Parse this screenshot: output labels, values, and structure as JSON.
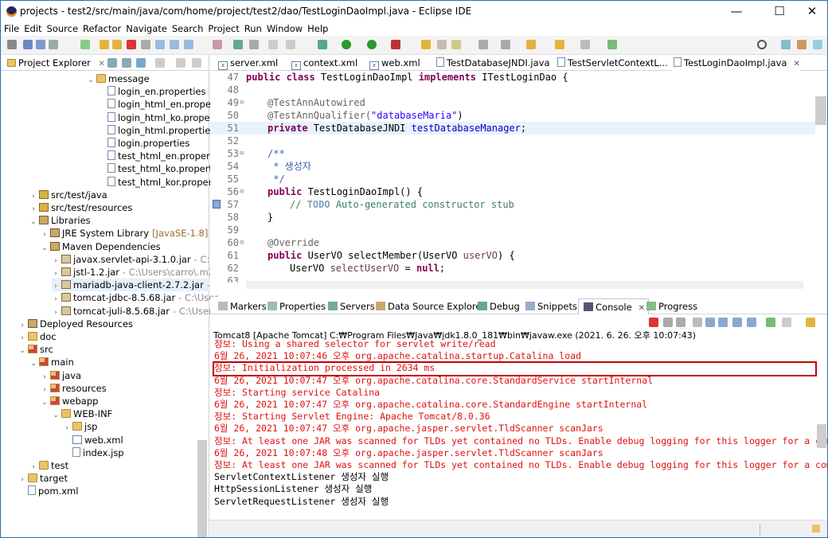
{
  "window": {
    "title": "projects - test2/src/main/java/com/home/project/test2/dao/TestLoginDaoImpl.java - Eclipse IDE",
    "minimize": "—",
    "maximize": "☐",
    "close": "✕"
  },
  "menu": [
    "File",
    "Edit",
    "Source",
    "Refactor",
    "Navigate",
    "Search",
    "Project",
    "Run",
    "Window",
    "Help"
  ],
  "explorer": {
    "title": "Project Explorer",
    "close": "✕",
    "tree": [
      {
        "label": "message",
        "icon": "folder-icon",
        "arrow": "⌄"
      },
      {
        "label": "login_en.properties",
        "icon": "file-icon"
      },
      {
        "label": "login_html_en.prope",
        "icon": "file-icon"
      },
      {
        "label": "login_html_ko.prope",
        "icon": "file-icon"
      },
      {
        "label": "login_html.propertie",
        "icon": "file-icon"
      },
      {
        "label": "login.properties",
        "icon": "file-icon"
      },
      {
        "label": "test_html_en.propert",
        "icon": "file-icon"
      },
      {
        "label": "test_html_ko.propert",
        "icon": "file-icon"
      },
      {
        "label": "test_html_kor.proper",
        "icon": "file-icon"
      },
      {
        "label": "src/test/java",
        "icon": "package-folder-icon",
        "arrow": "›"
      },
      {
        "label": "src/test/resources",
        "icon": "package-folder-icon",
        "arrow": "›"
      },
      {
        "label": "Libraries",
        "icon": "library-icon",
        "arrow": "⌄"
      },
      {
        "label": "JRE System Library",
        "extra": "[JavaSE-1.8]",
        "icon": "library-icon",
        "arrow": "›"
      },
      {
        "label": "Maven Dependencies",
        "icon": "library-icon",
        "arrow": "⌄"
      },
      {
        "label": "javax.servlet-api-3.1.0.jar",
        "extra": "- C:\\U",
        "icon": "jar-icon",
        "arrow": "›"
      },
      {
        "label": "jstl-1.2.jar",
        "extra": "- C:\\Users\\carro\\.m2",
        "icon": "jar-icon",
        "arrow": "›"
      },
      {
        "label": "mariadb-java-client-2.7.2.jar",
        "extra": "- C:",
        "icon": "jar-icon",
        "arrow": "›"
      },
      {
        "label": "tomcat-jdbc-8.5.68.jar",
        "extra": "- C:\\User",
        "icon": "jar-icon",
        "arrow": "›"
      },
      {
        "label": "tomcat-juli-8.5.68.jar",
        "extra": "- C:\\User",
        "icon": "jar-icon",
        "arrow": "›"
      },
      {
        "label": "Deployed Resources",
        "icon": "deployed-icon",
        "arrow": "›"
      },
      {
        "label": "doc",
        "icon": "folder-icon",
        "arrow": "›"
      },
      {
        "label": "src",
        "icon": "src-folder-icon",
        "arrow": "⌄"
      },
      {
        "label": "main",
        "icon": "src-folder-icon",
        "arrow": "⌄"
      },
      {
        "label": "java",
        "icon": "src-folder-icon",
        "arrow": "›"
      },
      {
        "label": "resources",
        "icon": "src-folder-icon",
        "arrow": "›"
      },
      {
        "label": "webapp",
        "icon": "src-folder-icon",
        "arrow": "⌄"
      },
      {
        "label": "WEB-INF",
        "icon": "folder-icon",
        "arrow": "⌄"
      },
      {
        "label": "jsp",
        "icon": "folder-icon",
        "arrow": "›"
      },
      {
        "label": "web.xml",
        "icon": "xml-file-icon"
      },
      {
        "label": "index.jsp",
        "icon": "file-icon"
      },
      {
        "label": "test",
        "icon": "folder-icon",
        "arrow": "›"
      },
      {
        "label": "target",
        "icon": "folder-icon",
        "arrow": "›"
      },
      {
        "label": "pom.xml",
        "icon": "maven-file-icon"
      }
    ]
  },
  "editor": {
    "tabs": [
      "server.xml",
      "context.xml",
      "web.xml",
      "TestDatabaseJNDI.java",
      "TestServletContextL...",
      "TestLoginDaoImpl.java"
    ],
    "close": "✕",
    "lines": [
      {
        "n": "47"
      },
      {
        "n": "48"
      },
      {
        "n": "49"
      },
      {
        "n": "50"
      },
      {
        "n": "51"
      },
      {
        "n": "52"
      },
      {
        "n": "53"
      },
      {
        "n": "54"
      },
      {
        "n": "55"
      },
      {
        "n": "56"
      },
      {
        "n": "57"
      },
      {
        "n": "58"
      },
      {
        "n": "59"
      },
      {
        "n": "60"
      },
      {
        "n": "61"
      },
      {
        "n": "62"
      },
      {
        "n": "63"
      }
    ],
    "code": {
      "l47a": "public class",
      "l47b": " TestLoginDaoImpl ",
      "l47c": "implements",
      "l47d": " ITestLoginDao {",
      "l49": "@TestAnnAutowired",
      "l50a": "@TestAnnQualifier(",
      "l50b": "\"databaseMaria\"",
      "l50c": ")",
      "l51a": "private",
      "l51b": " TestDatabaseJNDI ",
      "l51c": "testDatabaseManager",
      "l51d": ";",
      "l53": "/**",
      "l54": " * 생성자",
      "l55": " */",
      "l56a": "public",
      "l56b": " TestLoginDaoImpl() {",
      "l57a": "// ",
      "l57b": "TODO",
      "l57c": " Auto-generated constructor stub",
      "l58": "}",
      "l60": "@Override",
      "l61a": "public",
      "l61b": " UserVO selectMember(UserVO ",
      "l61c": "userVO",
      "l61d": ") {",
      "l62a": "UserVO ",
      "l62b": "selectUserVO",
      "l62c": " = ",
      "l62d": "null",
      "l62e": ";"
    },
    "folds": {
      "49": "⊖",
      "53": "⊖",
      "56": "⊖",
      "60": "⊖"
    }
  },
  "console": {
    "tabs": [
      "Markers",
      "Properties",
      "Servers",
      "Data Source Explorer",
      "Debug",
      "Snippets",
      "Console",
      "Progress"
    ],
    "close": "✕",
    "header": "Tomcat8 [Apache Tomcat] C:₩Program Files₩Java₩jdk1.8.0_181₩bin₩javaw.exe  (2021. 6. 26. 오후 10:07:43)",
    "lines": [
      {
        "t": "정보: Using a shared selector for servlet write/read",
        "c": "red"
      },
      {
        "t": "6월 26, 2021 10:07:46 오후 org.apache.catalina.startup.Catalina load",
        "c": "red"
      },
      {
        "t": "정보: Initialization processed in 2634 ms",
        "c": "red"
      },
      {
        "t": "6월 26, 2021 10:07:47 오후 org.apache.catalina.core.StandardService startInternal",
        "c": "red"
      },
      {
        "t": "정보: Starting service Catalina",
        "c": "red"
      },
      {
        "t": "6월 26, 2021 10:07:47 오후 org.apache.catalina.core.StandardEngine startInternal",
        "c": "red"
      },
      {
        "t": "정보: Starting Servlet Engine: Apache Tomcat/8.0.36",
        "c": "red"
      },
      {
        "t": "6월 26, 2021 10:07:47 오후 org.apache.jasper.servlet.TldScanner scanJars",
        "c": "red"
      },
      {
        "t": "정보: At least one JAR was scanned for TLDs yet contained no TLDs. Enable debug logging for this logger for a comp",
        "c": "red"
      },
      {
        "t": "6월 26, 2021 10:07:48 오후 org.apache.jasper.servlet.TldScanner scanJars",
        "c": "red"
      },
      {
        "t": "정보: At least one JAR was scanned for TLDs yet contained no TLDs. Enable debug logging for this logger for a comp",
        "c": "red"
      },
      {
        "t": "ServletContextListener 생성자 실행",
        "c": "black"
      },
      {
        "t": "HttpSessionListener 생성자 실행",
        "c": "black"
      },
      {
        "t": "ServletRequestListener 생성자 실행",
        "c": "black"
      }
    ],
    "highlighted_line_index": 2
  },
  "colors": {
    "keyword": "#7f0055",
    "string": "#2a00ff",
    "console_error": "#e01010",
    "highlight_box": "#c00000"
  }
}
